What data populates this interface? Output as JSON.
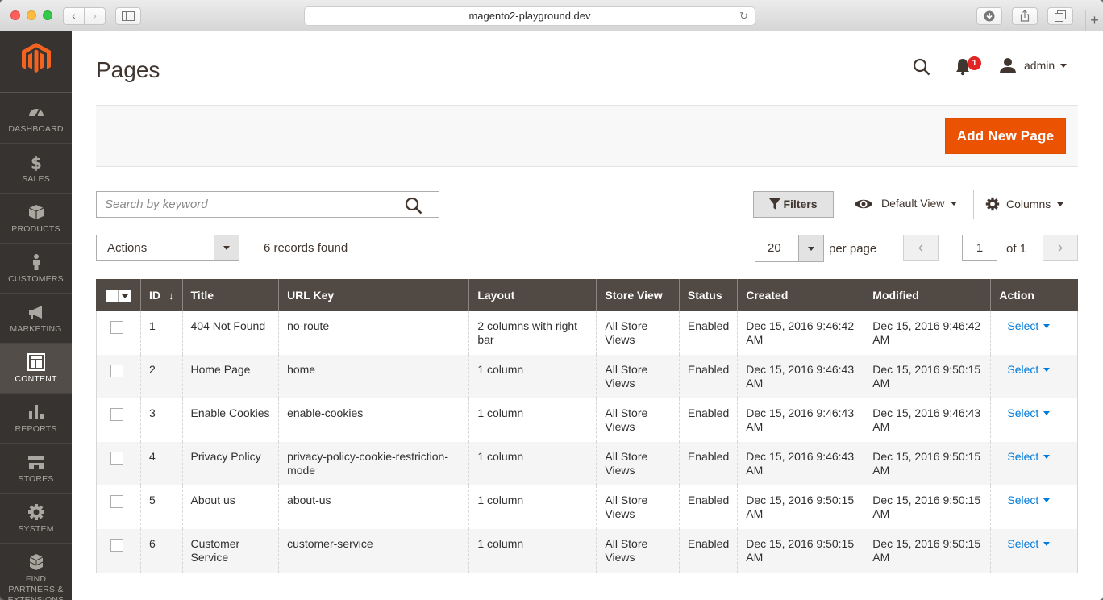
{
  "browser": {
    "url": "magento2-playground.dev"
  },
  "sidebar": {
    "items": [
      {
        "label": "DASHBOARD"
      },
      {
        "label": "SALES"
      },
      {
        "label": "PRODUCTS"
      },
      {
        "label": "CUSTOMERS"
      },
      {
        "label": "MARKETING"
      },
      {
        "label": "CONTENT"
      },
      {
        "label": "REPORTS"
      },
      {
        "label": "STORES"
      },
      {
        "label": "SYSTEM"
      },
      {
        "label": "FIND PARTNERS & EXTENSIONS"
      }
    ],
    "active": "CONTENT"
  },
  "header": {
    "title": "Pages",
    "notification_count": "1",
    "user": "admin"
  },
  "actions": {
    "add_new": "Add New Page"
  },
  "toolbar": {
    "search_placeholder": "Search by keyword",
    "filters": "Filters",
    "view": "Default View",
    "columns": "Columns",
    "mass_action": "Actions",
    "records": "6 records found",
    "per_page_value": "20",
    "per_page_label": "per page",
    "page_current": "1",
    "page_total": "of 1"
  },
  "table": {
    "headers": [
      "ID",
      "Title",
      "URL Key",
      "Layout",
      "Store View",
      "Status",
      "Created",
      "Modified",
      "Action"
    ],
    "rows": [
      {
        "id": "1",
        "title": "404 Not Found",
        "url_key": "no-route",
        "layout": "2 columns with right bar",
        "store_view": "All Store Views",
        "status": "Enabled",
        "created": "Dec 15, 2016 9:46:42 AM",
        "modified": "Dec 15, 2016 9:46:42 AM",
        "action": "Select"
      },
      {
        "id": "2",
        "title": "Home Page",
        "url_key": "home",
        "layout": "1 column",
        "store_view": "All Store Views",
        "status": "Enabled",
        "created": "Dec 15, 2016 9:46:43 AM",
        "modified": "Dec 15, 2016 9:50:15 AM",
        "action": "Select"
      },
      {
        "id": "3",
        "title": "Enable Cookies",
        "url_key": "enable-cookies",
        "layout": "1 column",
        "store_view": "All Store Views",
        "status": "Enabled",
        "created": "Dec 15, 2016 9:46:43 AM",
        "modified": "Dec 15, 2016 9:46:43 AM",
        "action": "Select"
      },
      {
        "id": "4",
        "title": "Privacy Policy",
        "url_key": "privacy-policy-cookie-restriction-mode",
        "layout": "1 column",
        "store_view": "All Store Views",
        "status": "Enabled",
        "created": "Dec 15, 2016 9:46:43 AM",
        "modified": "Dec 15, 2016 9:50:15 AM",
        "action": "Select"
      },
      {
        "id": "5",
        "title": "About us",
        "url_key": "about-us",
        "layout": "1 column",
        "store_view": "All Store Views",
        "status": "Enabled",
        "created": "Dec 15, 2016 9:50:15 AM",
        "modified": "Dec 15, 2016 9:50:15 AM",
        "action": "Select"
      },
      {
        "id": "6",
        "title": "Customer Service",
        "url_key": "customer-service",
        "layout": "1 column",
        "store_view": "All Store Views",
        "status": "Enabled",
        "created": "Dec 15, 2016 9:50:15 AM",
        "modified": "Dec 15, 2016 9:50:15 AM",
        "action": "Select"
      }
    ]
  },
  "colors": {
    "accent": "#eb5202",
    "sidebar_bg": "#373330",
    "table_header_bg": "#514943",
    "link": "#007bdb",
    "badge": "#e22626"
  }
}
